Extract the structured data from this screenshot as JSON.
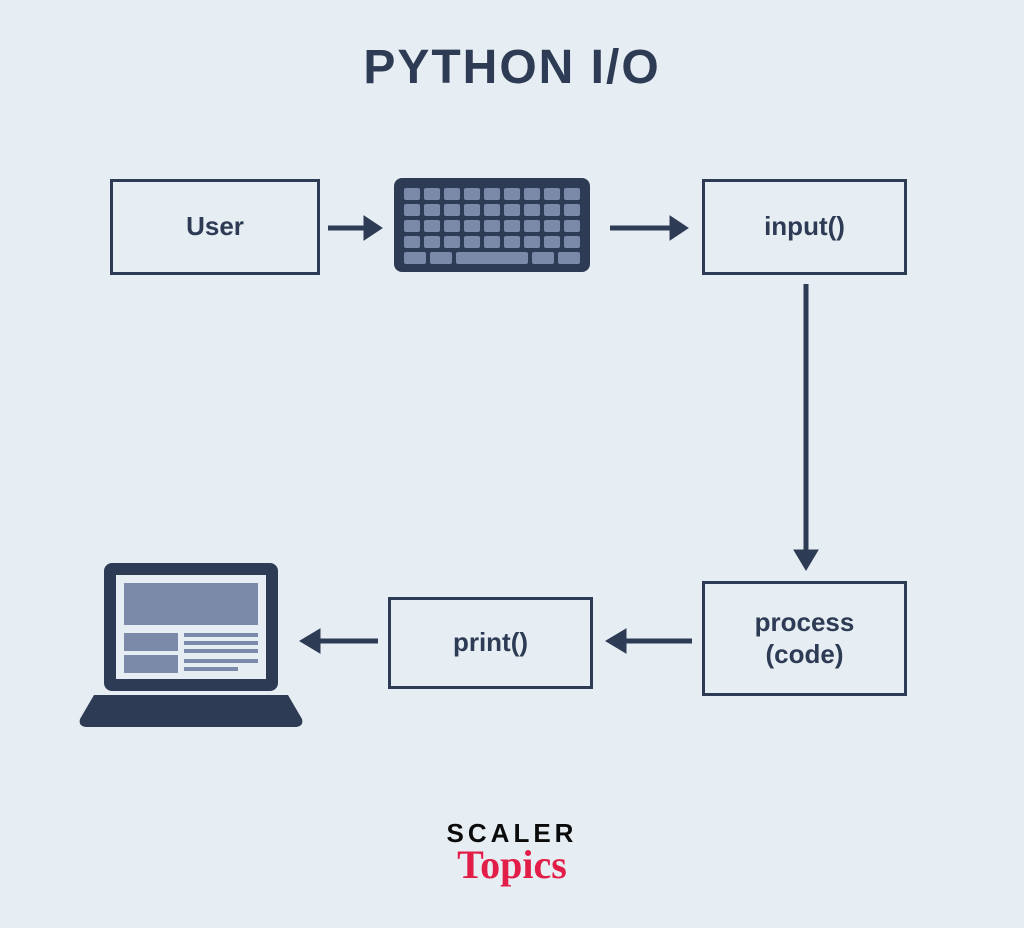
{
  "title": "PYTHON I/O",
  "nodes": {
    "user": "User",
    "keyboard_icon": "keyboard-icon",
    "input": "input()",
    "process": "process\n(code)",
    "print": "print()",
    "laptop_icon": "laptop-icon"
  },
  "flow": [
    "user -> keyboard",
    "keyboard -> input",
    "input -> process",
    "process -> print",
    "print -> laptop"
  ],
  "brand": {
    "line1": "SCALER",
    "line2": "Topics"
  },
  "colors": {
    "stroke": "#2e3b55",
    "bg": "#e6eef3",
    "accent_fill": "#7b8aa8",
    "brand_accent": "#e11d48"
  }
}
